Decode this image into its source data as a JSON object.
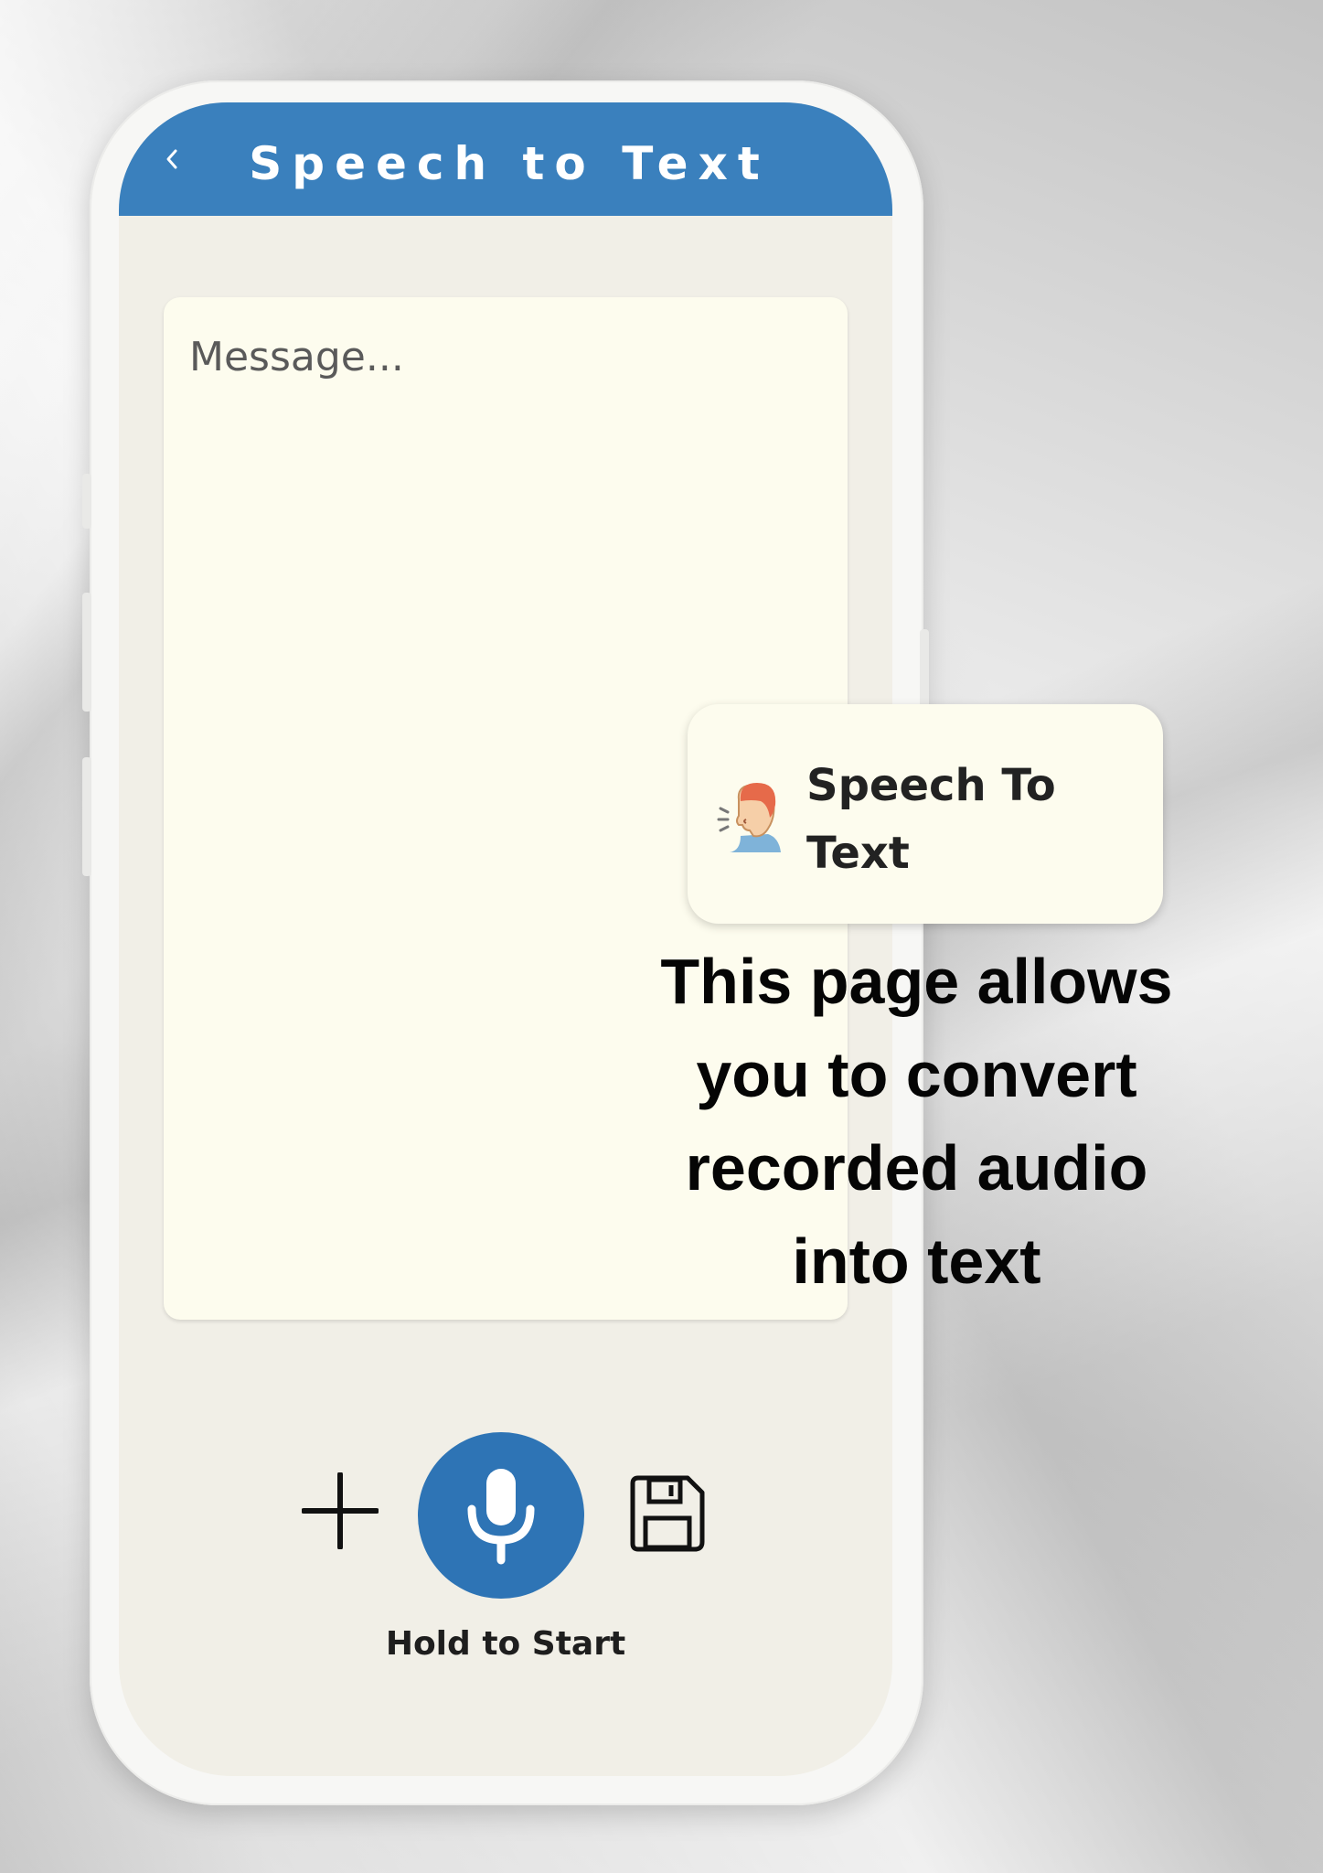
{
  "header": {
    "title": "Speech to Text",
    "back_icon": "chevron-left-icon"
  },
  "message": {
    "placeholder": "Message...",
    "value": ""
  },
  "controls": {
    "add_icon": "plus-icon",
    "mic_icon": "microphone-icon",
    "save_icon": "floppy-disk-icon",
    "hold_label": "Hold to Start"
  },
  "feature_card": {
    "icon": "speaking-person-icon",
    "title_line1": "Speech To",
    "title_line2": "Text"
  },
  "caption": {
    "line1": "This page allows",
    "line2": "you to convert",
    "line3": "recorded audio",
    "line4": "into text"
  },
  "colors": {
    "header_blue": "#3a80bd",
    "mic_blue": "#2e74b5",
    "screen_bg": "#f1efe7",
    "message_bg": "#fdfcee"
  }
}
